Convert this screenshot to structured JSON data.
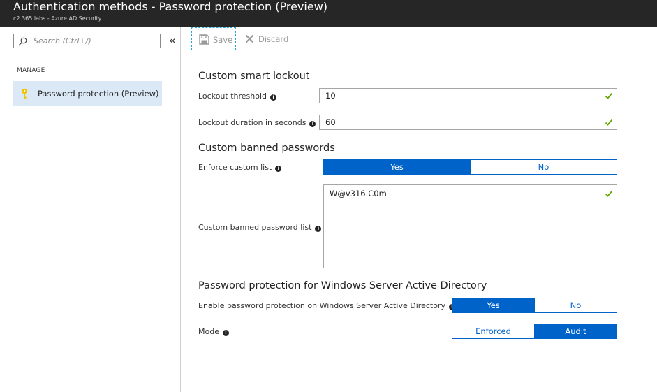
{
  "header": {
    "title": "Authentication methods - Password protection (Preview)",
    "subtitle": "c2 365 labs - Azure AD Security"
  },
  "sidebar": {
    "search_placeholder": "Search (Ctrl+/)",
    "collapse_glyph": "«",
    "section_label": "MANAGE",
    "items": [
      {
        "label": "Password protection (Preview)",
        "icon": "key-icon",
        "selected": true
      }
    ]
  },
  "toolbar": {
    "save_label": "Save",
    "discard_label": "Discard"
  },
  "lockout": {
    "title": "Custom smart lockout",
    "threshold_label": "Lockout threshold",
    "threshold_value": "10",
    "duration_label": "Lockout duration in seconds",
    "duration_value": "60"
  },
  "banned": {
    "title": "Custom banned passwords",
    "enforce_label": "Enforce custom list",
    "enforce_options": [
      "Yes",
      "No"
    ],
    "enforce_selected": "Yes",
    "list_label": "Custom banned password list",
    "list_value": "W@v316.C0m"
  },
  "windows": {
    "title": "Password protection for Windows Server Active Directory",
    "enable_label": "Enable password protection on Windows Server Active Directory",
    "enable_options": [
      "Yes",
      "No"
    ],
    "enable_selected": "Yes",
    "mode_label": "Mode",
    "mode_options": [
      "Enforced",
      "Audit"
    ],
    "mode_selected": "Audit"
  },
  "colors": {
    "accent": "#0063c9",
    "check": "#5fa800",
    "header_bg": "#262626",
    "selected_nav_bg": "#dbe9f7"
  }
}
